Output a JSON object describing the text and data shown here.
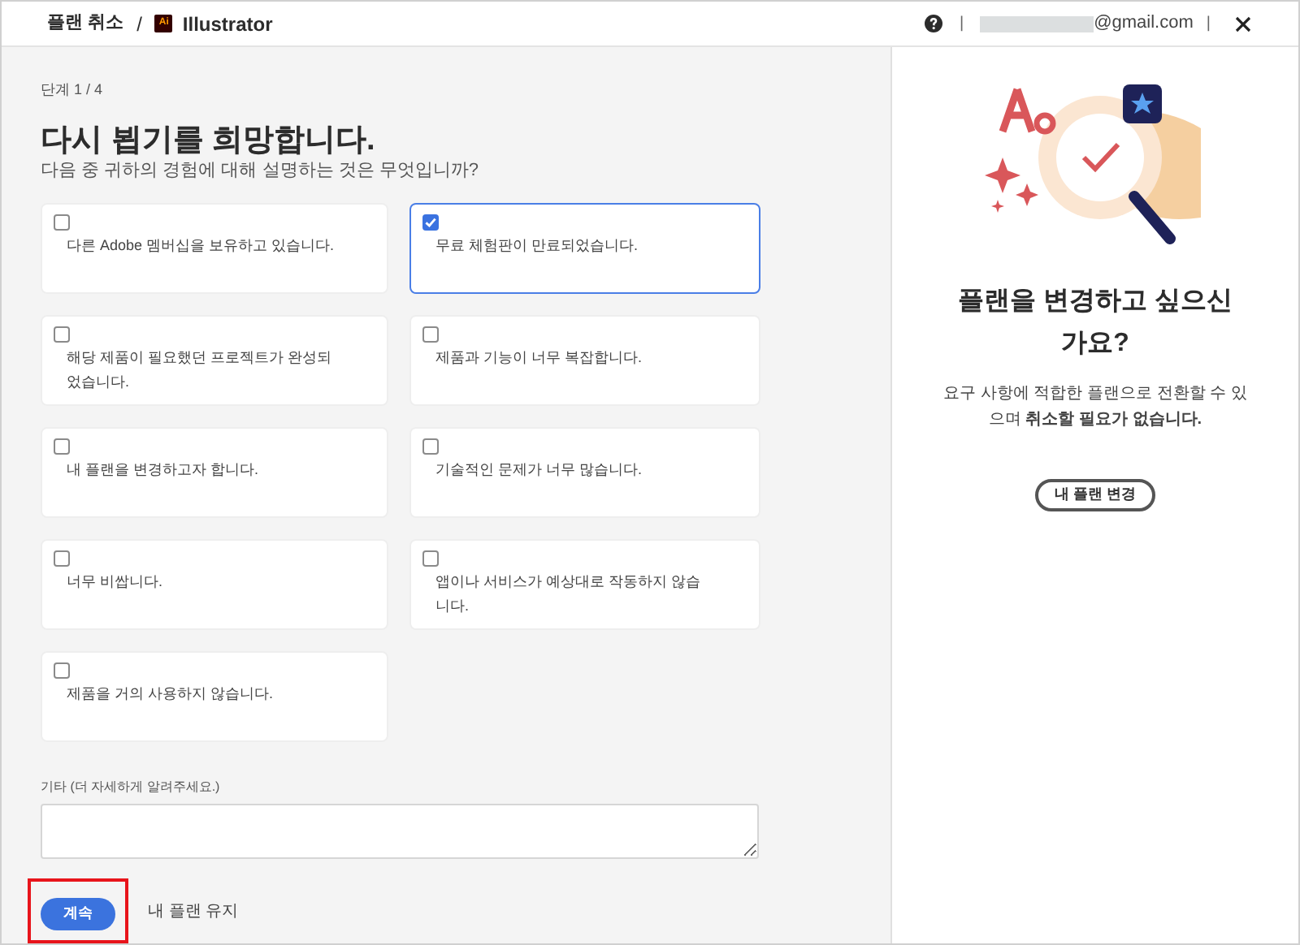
{
  "header": {
    "title": "플랜 취소",
    "separator": "/",
    "app_badge": "Ai",
    "app_name": "Illustrator",
    "email": "@gmail.com",
    "divider": "|"
  },
  "step": "단계 1 / 4",
  "heading": "다시 뵙기를 희망합니다.",
  "subheading": "다음 중 귀하의 경험에 대해 설명하는 것은 무엇입니까?",
  "options": [
    {
      "label": "다른 Adobe 멤버십을 보유하고 있습니다.",
      "checked": false
    },
    {
      "label": "무료 체험판이 만료되었습니다.",
      "checked": true
    },
    {
      "label": "해당 제품이 필요했던 프로젝트가 완성되었습니다.",
      "checked": false
    },
    {
      "label": "제품과 기능이 너무 복잡합니다.",
      "checked": false
    },
    {
      "label": "내 플랜을 변경하고자 합니다.",
      "checked": false
    },
    {
      "label": "기술적인 문제가 너무 많습니다.",
      "checked": false
    },
    {
      "label": "너무 비쌉니다.",
      "checked": false
    },
    {
      "label": "앱이나 서비스가 예상대로 작동하지 않습니다.",
      "checked": false
    },
    {
      "label": "제품을 거의 사용하지 않습니다.",
      "checked": false
    }
  ],
  "other_field": {
    "label": "기타 (더 자세하게 알려주세요.)"
  },
  "continue_button": {
    "label": "계속",
    "highlighted": true
  },
  "keep_link": "내 플랜 유지",
  "side_panel": {
    "title": "플랜을 변경하고 싶으신가요?",
    "description": "요구 사항에 적합한 플랜으로 전환할 수 있으며 **취소할 필요가 없습니다.**",
    "button": "내 플랜 변경"
  }
}
